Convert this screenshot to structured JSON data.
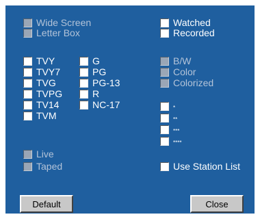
{
  "colors": {
    "panel_background": "#1f5f9f",
    "label_text": "#ffffff",
    "disabled_label_text": "#b3c3d8",
    "button_face": "#c8c8c8"
  },
  "display_format": {
    "wide_screen": "Wide Screen",
    "letter_box": "Letter Box"
  },
  "recording_status": {
    "watched": "Watched",
    "recorded": "Recorded"
  },
  "tv_ratings": [
    "TVY",
    "TVY7",
    "TVG",
    "TVPG",
    "TV14",
    "TVM"
  ],
  "mpaa_ratings": [
    "G",
    "PG",
    "PG-13",
    "R",
    "NC-17"
  ],
  "color_mode": {
    "bw": "B/W",
    "color": "Color",
    "colorized": "Colorized"
  },
  "star_ratings": [
    "*",
    "**",
    "***",
    "****"
  ],
  "broadcast_type": {
    "live": "Live",
    "taped": "Taped"
  },
  "station_list": {
    "use_station_list": "Use Station List"
  },
  "buttons": {
    "default": "Default",
    "close": "Close"
  }
}
